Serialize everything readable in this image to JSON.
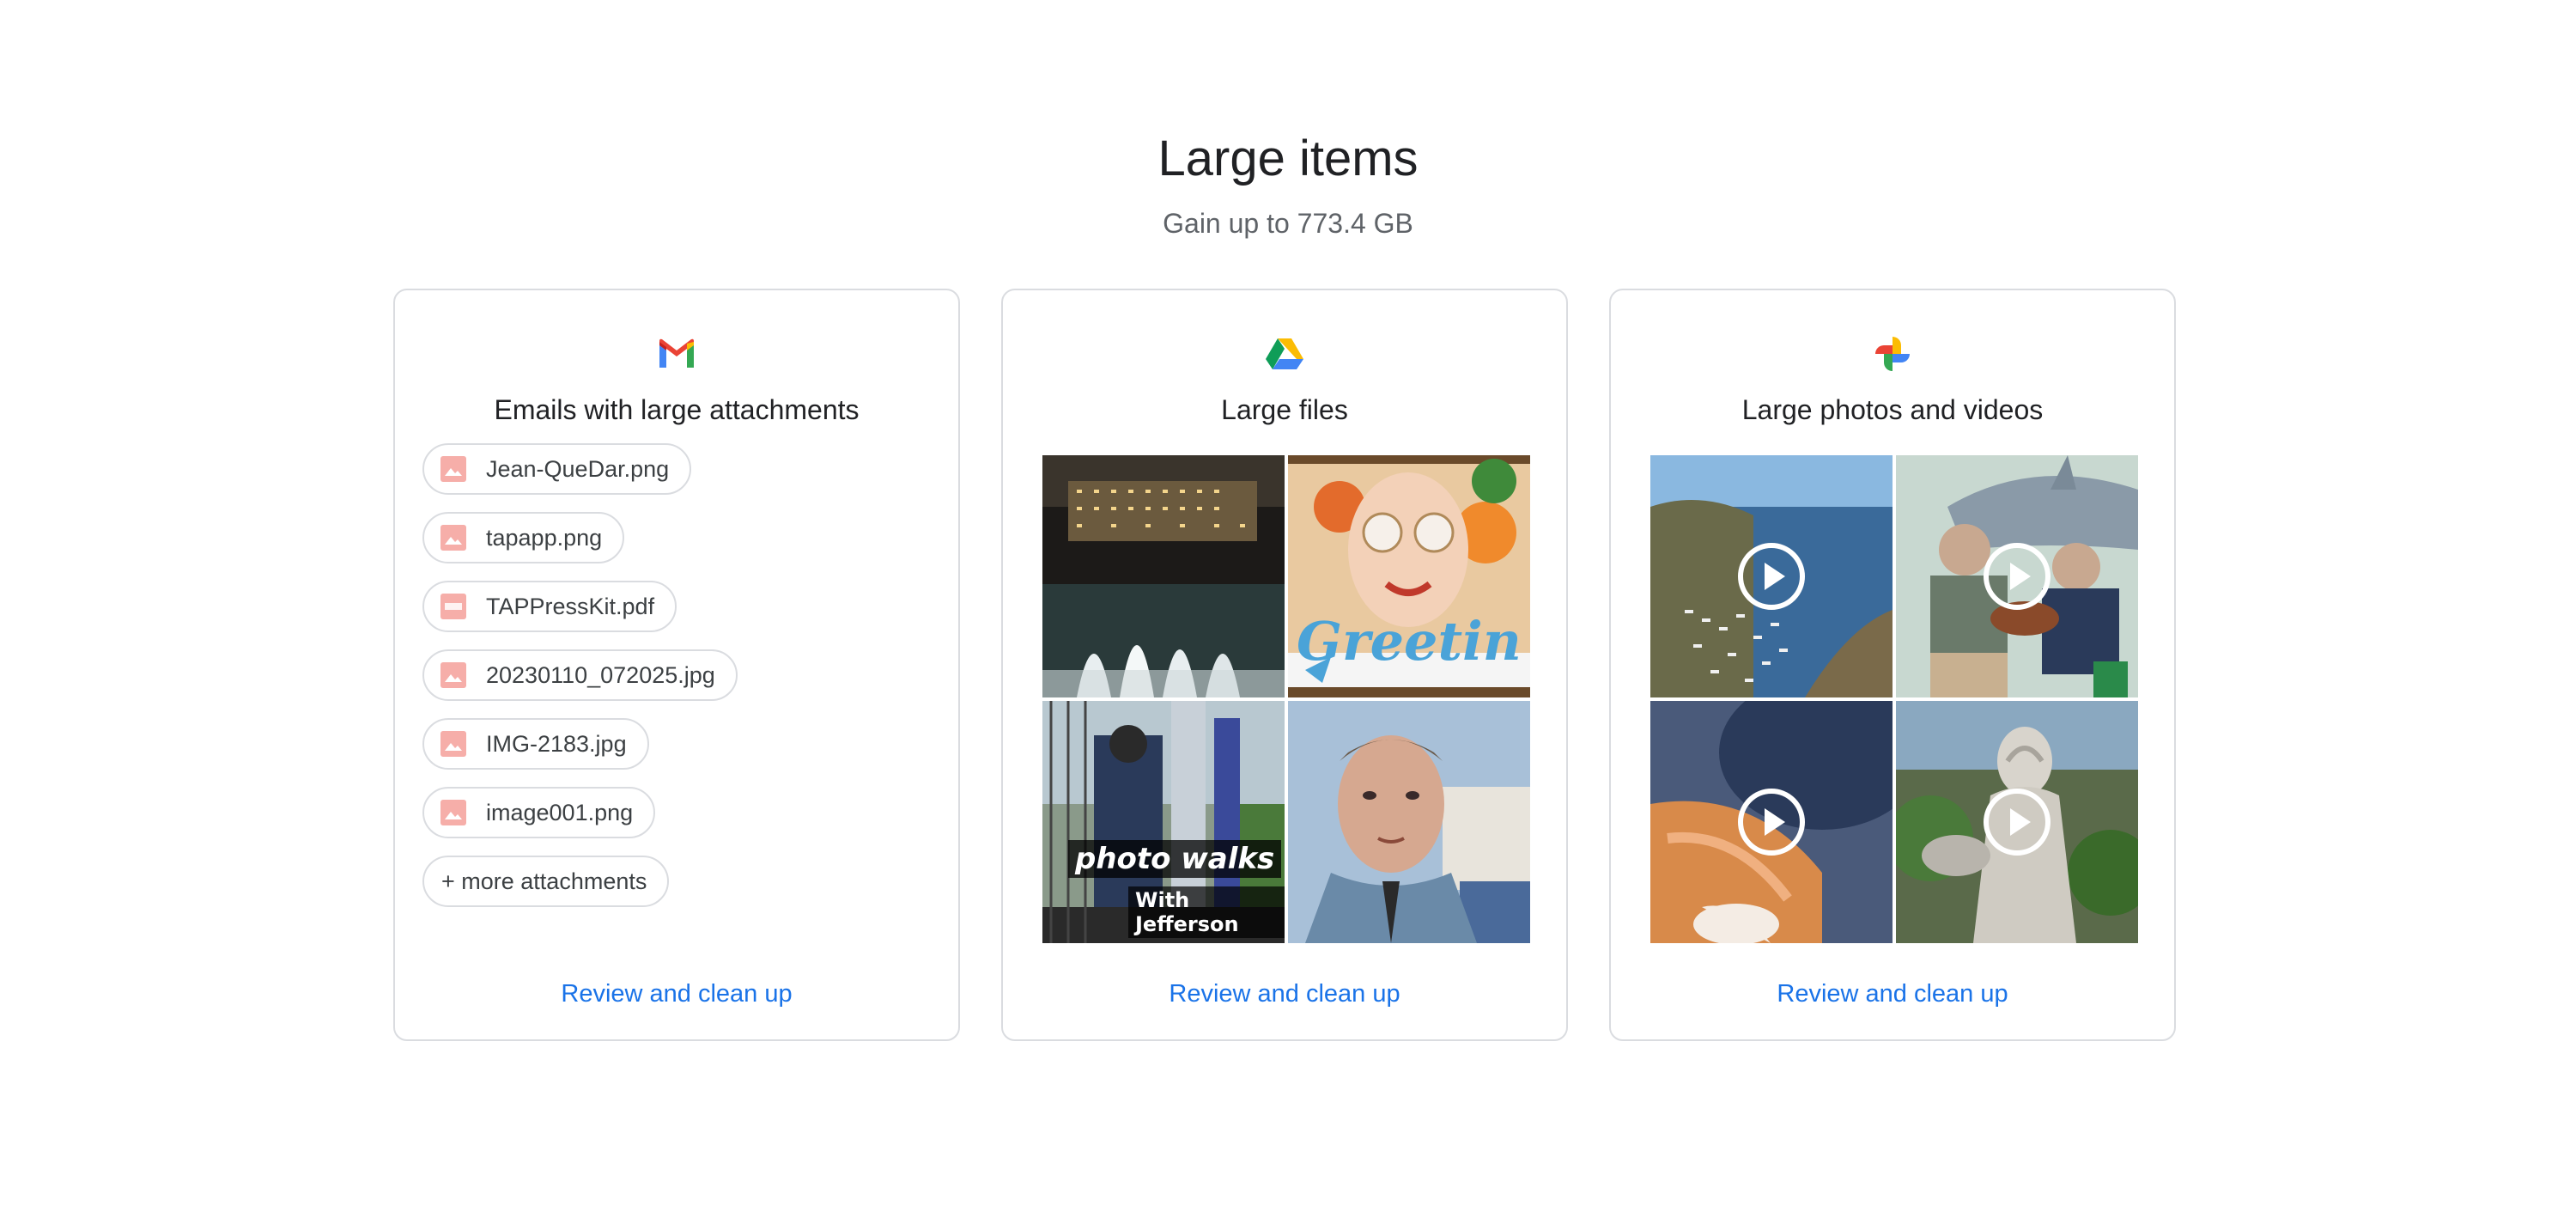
{
  "page": {
    "title": "Large items",
    "subtitle": "Gain up to 773.4 GB"
  },
  "colors": {
    "link": "#1a73e8",
    "border": "#dadce0",
    "chip_icon": "#f28b82"
  },
  "cards": [
    {
      "icon": "gmail-icon",
      "title": "Emails with large attachments",
      "attachments": [
        {
          "name": "Jean-QueDar.png",
          "icon": "image-file-icon"
        },
        {
          "name": "tapapp.png",
          "icon": "image-file-icon"
        },
        {
          "name": "TAPPressKit.pdf",
          "icon": "pdf-file-icon"
        },
        {
          "name": "20230110_072025.jpg",
          "icon": "image-file-icon"
        },
        {
          "name": "IMG-2183.jpg",
          "icon": "image-file-icon"
        },
        {
          "name": "image001.png",
          "icon": "image-file-icon"
        }
      ],
      "more_label": "+ more attachments",
      "action": "Review and clean up"
    },
    {
      "icon": "google-drive-icon",
      "title": "Large files",
      "thumbnails": [
        {
          "icon": "fountain-night-thumbnail"
        },
        {
          "icon": "greeting-poster-thumbnail",
          "text": "Greetin"
        },
        {
          "icon": "photo-walks-thumbnail",
          "text": "photo walks",
          "caption": "With Jefferson"
        },
        {
          "icon": "man-portrait-thumbnail"
        }
      ],
      "action": "Review and clean up"
    },
    {
      "icon": "google-photos-icon",
      "title": "Large photos and videos",
      "thumbnails": [
        {
          "icon": "harbor-video-thumbnail",
          "video": true
        },
        {
          "icon": "shark-guitar-video-thumbnail",
          "video": true
        },
        {
          "icon": "cat-video-thumbnail",
          "video": true
        },
        {
          "icon": "statue-video-thumbnail",
          "video": true
        }
      ],
      "action": "Review and clean up"
    }
  ]
}
